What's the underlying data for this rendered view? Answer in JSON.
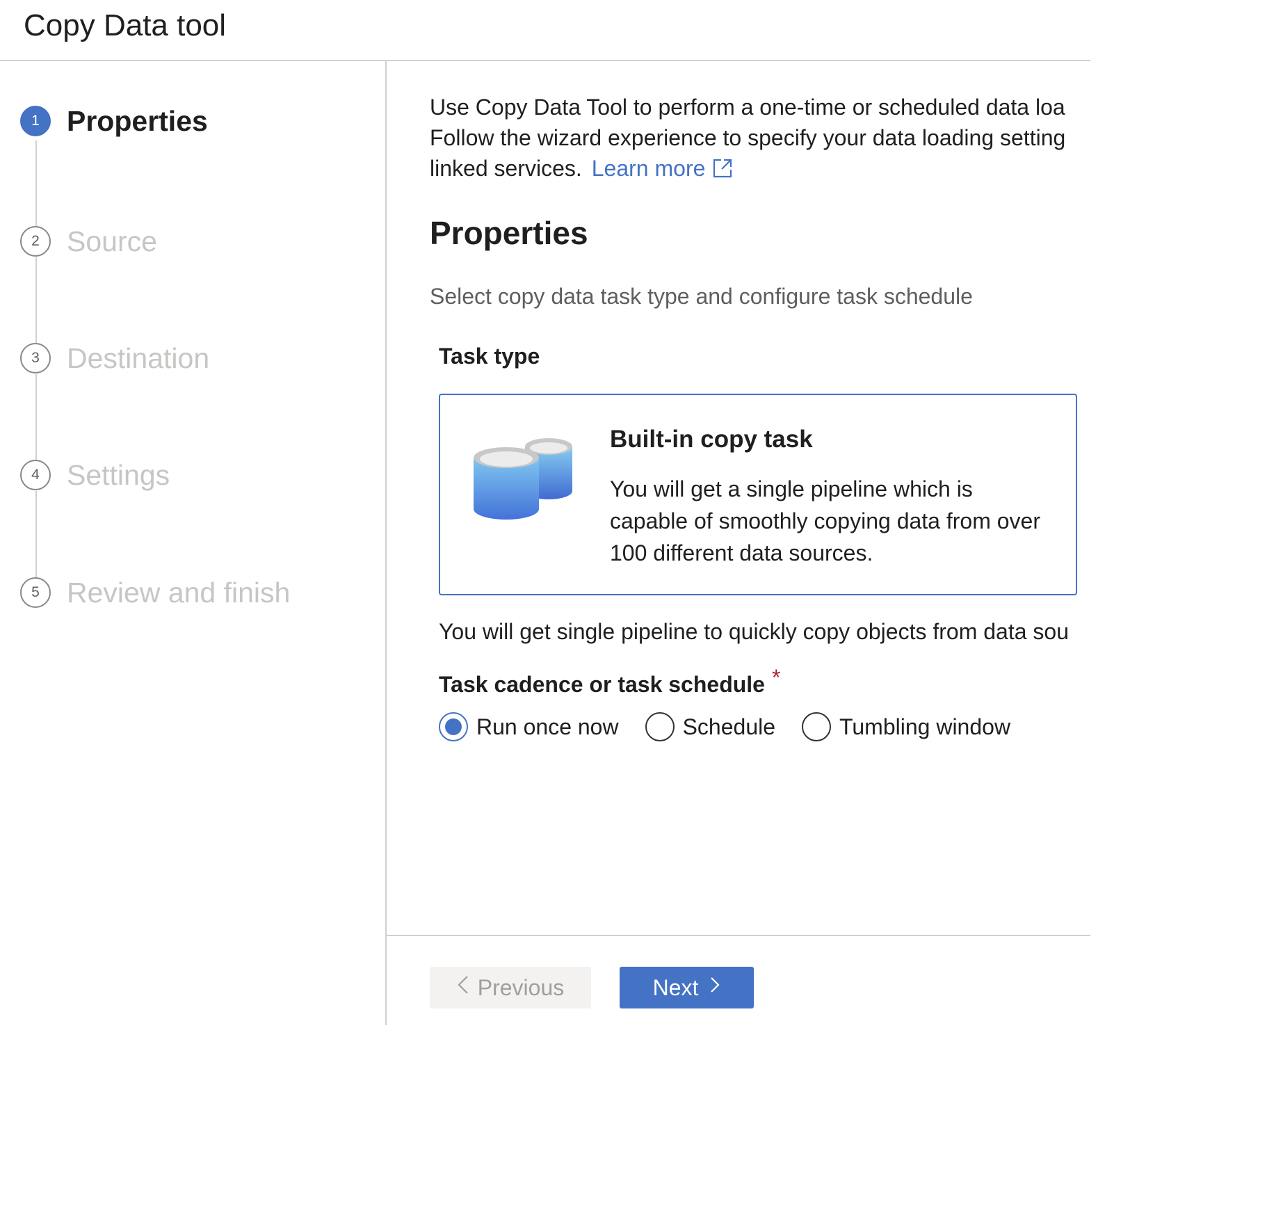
{
  "app": {
    "title": "Copy Data tool"
  },
  "steps": [
    {
      "number": "1",
      "label": "Properties",
      "state": "active"
    },
    {
      "number": "2",
      "label": "Source",
      "state": "inactive"
    },
    {
      "number": "3",
      "label": "Destination",
      "state": "inactive"
    },
    {
      "number": "4",
      "label": "Settings",
      "state": "inactive"
    },
    {
      "number": "5",
      "label": "Review and finish",
      "state": "inactive"
    }
  ],
  "intro": {
    "line1": "Use Copy Data Tool to perform a one-time or scheduled data loa",
    "line2": "Follow the wizard experience to specify your data loading setting",
    "line3": "linked services.",
    "learn_more": "Learn more",
    "learn_more_icon": "external-link-icon"
  },
  "properties": {
    "title": "Properties",
    "subtitle": "Select copy data task type and configure task schedule",
    "task_type_label": "Task type",
    "task_card": {
      "icon": "database-cylinders-icon",
      "title": "Built-in copy task",
      "description": "You will get a single pipeline which is capable of smoothly copying data from over 100 different data sources."
    },
    "note": "You will get single pipeline to quickly copy objects from data sou",
    "schedule_label": "Task cadence or task schedule",
    "required_marker": "*",
    "schedule_options": [
      {
        "label": "Run once now",
        "selected": true
      },
      {
        "label": "Schedule",
        "selected": false
      },
      {
        "label": "Tumbling window",
        "selected": false
      }
    ]
  },
  "footer": {
    "previous_label": "Previous",
    "next_label": "Next",
    "previous_enabled": false
  },
  "colors": {
    "accent": "#4472c4",
    "required": "#a4262c",
    "divider": "#d2d0ce",
    "inactive_text": "#c8c6c4"
  }
}
